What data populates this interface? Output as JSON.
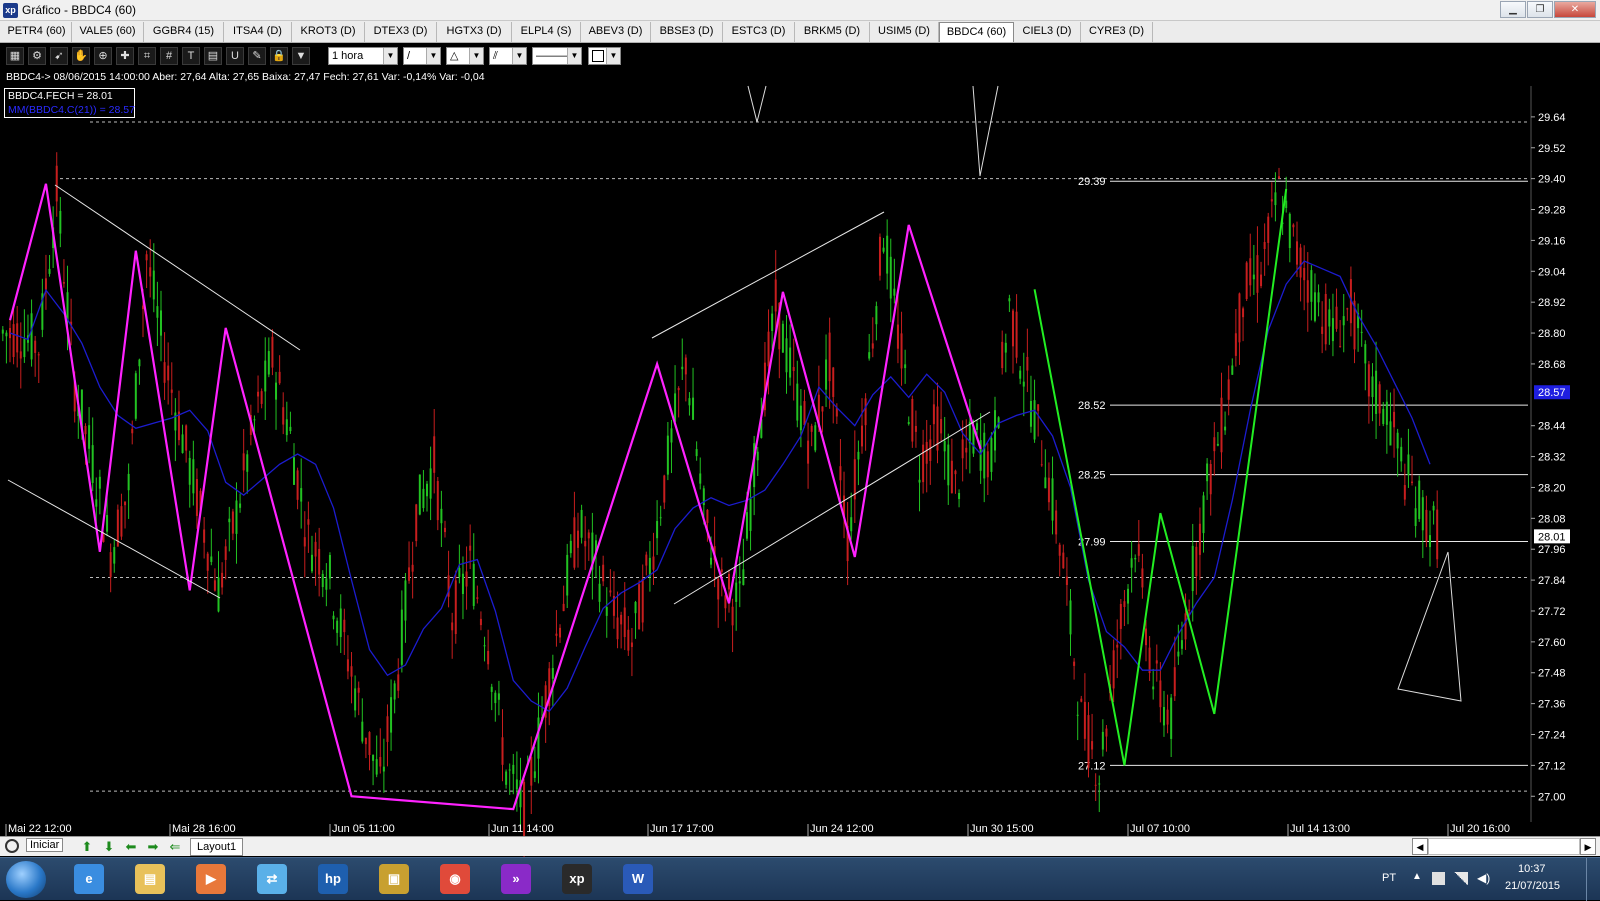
{
  "window": {
    "title": "Gráfico - BBDC4 (60)",
    "app_icon_text": "xp",
    "minimize_glyph": "▁",
    "maximize_glyph": "❐",
    "close_glyph": "✕"
  },
  "tabs": [
    {
      "label": "PETR4 (60)",
      "active": false
    },
    {
      "label": "VALE5 (60)",
      "active": false
    },
    {
      "label": "GGBR4 (15)",
      "active": false
    },
    {
      "label": "ITSA4 (D)",
      "active": false
    },
    {
      "label": "KROT3 (D)",
      "active": false
    },
    {
      "label": "DTEX3 (D)",
      "active": false
    },
    {
      "label": "HGTX3 (D)",
      "active": false
    },
    {
      "label": "ELPL4 (S)",
      "active": false
    },
    {
      "label": "ABEV3 (D)",
      "active": false
    },
    {
      "label": "BBSE3 (D)",
      "active": false
    },
    {
      "label": "ESTC3 (D)",
      "active": false
    },
    {
      "label": "BRKM5 (D)",
      "active": false
    },
    {
      "label": "USIM5 (D)",
      "active": false
    },
    {
      "label": "BBDC4 (60)",
      "active": true
    },
    {
      "label": "CIEL3 (D)",
      "active": false
    },
    {
      "label": "CYRE3 (D)",
      "active": false
    }
  ],
  "toolbar": {
    "icons": [
      "chart-icon",
      "gear-icon",
      "cursor-icon",
      "hand-icon",
      "magnifier-icon",
      "crosshair-icon",
      "fibonacci-icon",
      "gann-icon",
      "text-icon",
      "calculator-icon",
      "u-tool-icon",
      "eraser-icon",
      "lock-icon",
      "filter-icon"
    ],
    "glyphs": [
      "▦",
      "⚙",
      "➹",
      "✋",
      "⊕",
      "✚",
      "⌗",
      "#",
      "T",
      "▤",
      "U",
      "✎",
      "🔒",
      "▼"
    ],
    "period_value": "1 hora",
    "line_tool": "/",
    "shape_tool": "△",
    "channel_tool": "⫽",
    "line_style": "———",
    "color_swatch": "#ffffff"
  },
  "info_line": "BBDC4-> 08/06/2015 14:00:00 Aber: 27,64 Alta: 27,65 Baixa: 27,47 Fech: 27,61 Var: -0,14% Var: -0,04",
  "legend": {
    "close_label": "BBDC4.FECH = 28.01",
    "ma_label": "MM(BBDC4.C(21)) = 28.57"
  },
  "chart_data": {
    "type": "candlestick",
    "symbol": "BBDC4",
    "interval": "60",
    "y_ticks": [
      29.64,
      29.52,
      29.4,
      29.28,
      29.16,
      29.04,
      28.92,
      28.8,
      28.68,
      28.57,
      28.44,
      28.32,
      28.2,
      28.08,
      28.01,
      27.96,
      27.84,
      27.72,
      27.6,
      27.48,
      27.36,
      27.24,
      27.12,
      27.0
    ],
    "y_tick_labels": [
      "29.64",
      "29.52",
      "29.40",
      "29.28",
      "29.16",
      "29.04",
      "28.92",
      "28.80",
      "28.68",
      "28.57",
      "28.44",
      "28.32",
      "28.20",
      "28.08",
      "28.01",
      "27.96",
      "27.84",
      "27.72",
      "27.60",
      "27.48",
      "27.36",
      "27.24",
      "27.12",
      "27.00"
    ],
    "highlight_ticks": [
      "28.57",
      "28.01"
    ],
    "x_labels": [
      "Mai 22 12:00",
      "Mai 28 16:00",
      "Jun 05 11:00",
      "Jun 11 14:00",
      "Jun 17 17:00",
      "Jun 24 12:00",
      "Jun 30 15:00",
      "Jul 07 10:00",
      "Jul 14 13:00",
      "Jul 20 16:00"
    ],
    "level_labels": [
      {
        "label": "29.39",
        "value": 29.39
      },
      {
        "label": "28.52",
        "value": 28.52
      },
      {
        "label": "28.25",
        "value": 28.25
      },
      {
        "label": "27.99",
        "value": 27.99
      },
      {
        "label": "27.12",
        "value": 27.12
      }
    ],
    "close_ma_series": {
      "closes": [
        28.8,
        28.75,
        29.35,
        28.6,
        28.3,
        27.95,
        28.2,
        29.1,
        28.7,
        28.4,
        28.1,
        27.8,
        28.1,
        28.45,
        28.7,
        28.4,
        28.0,
        27.9,
        27.6,
        27.3,
        27.05,
        27.5,
        28.1,
        28.3,
        27.7,
        27.9,
        27.6,
        27.1,
        26.95,
        27.3,
        27.7,
        28.05,
        27.9,
        27.7,
        27.6,
        27.9,
        28.3,
        28.7,
        28.1,
        27.8,
        27.75,
        28.4,
        28.9,
        28.6,
        28.35,
        28.7,
        28.0,
        28.55,
        29.2,
        28.7,
        28.3,
        28.45,
        28.2,
        28.4,
        28.3,
        28.9,
        28.6,
        28.3,
        27.9,
        27.3,
        27.1,
        27.6,
        28.0,
        27.45,
        27.3,
        27.8,
        28.2,
        28.5,
        28.95,
        29.05,
        29.35,
        29.1,
        28.95,
        28.8,
        28.9,
        28.6,
        28.5,
        28.25,
        28.1,
        28.0
      ],
      "ma_color": "#1c1ccf",
      "bull_color": "#22c322",
      "bear_color": "#c81e1e"
    },
    "zigzag_magenta": [
      [
        0,
        28.85
      ],
      [
        2,
        29.38
      ],
      [
        5,
        27.95
      ],
      [
        7,
        29.12
      ],
      [
        10,
        27.8
      ],
      [
        12,
        28.82
      ],
      [
        19,
        27.0
      ],
      [
        28,
        26.95
      ],
      [
        36,
        28.68
      ],
      [
        40,
        27.75
      ],
      [
        43,
        28.96
      ],
      [
        47,
        27.93
      ],
      [
        50,
        29.22
      ],
      [
        54,
        28.35
      ]
    ],
    "zigzag_green": [
      [
        57,
        28.97
      ],
      [
        62,
        27.12
      ],
      [
        64,
        28.1
      ],
      [
        67,
        27.32
      ],
      [
        71,
        29.36
      ]
    ],
    "zigzag_color_magenta": "#ff22ff",
    "zigzag_color_green": "#22ee22"
  },
  "navbar": {
    "start_label": "Iniciar",
    "layout_tab": "Layout1",
    "arrows": [
      "⬆",
      "⬇",
      "⬅",
      "➡",
      "⇐"
    ]
  },
  "taskbar": {
    "apps": [
      "internet-explorer-icon",
      "file-explorer-icon",
      "media-player-icon",
      "network-icon",
      "hp-icon",
      "app-icon",
      "chrome-icon",
      "xp-forward-icon",
      "xp-app-icon",
      "word-icon"
    ],
    "lang": "PT",
    "time": "10:37",
    "date": "21/07/2015"
  }
}
